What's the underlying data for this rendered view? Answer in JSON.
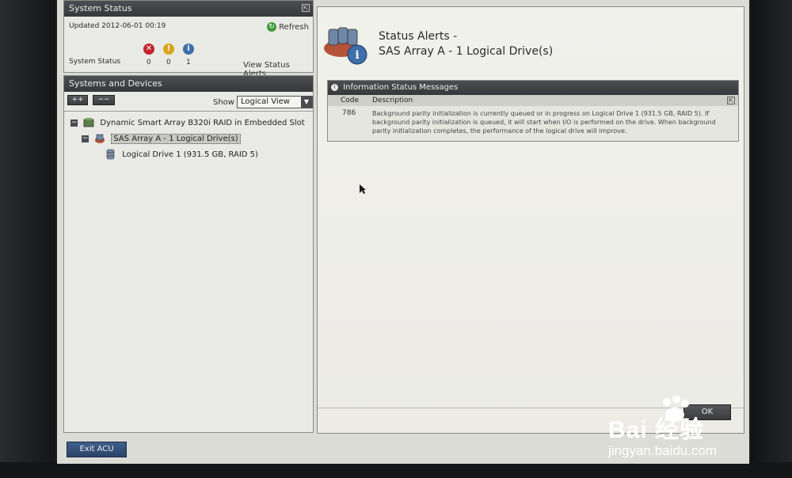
{
  "system_status": {
    "title": "System Status",
    "updated": "Updated 2012-06-01 00:19",
    "refresh": "Refresh",
    "label": "System Status",
    "counts": [
      "0",
      "0",
      "1"
    ],
    "view_alerts": "View Status Alerts"
  },
  "devices": {
    "title": "Systems and Devices",
    "expand_all": "++",
    "collapse_all": "−−",
    "show_label": "Show",
    "view_option": "Logical View",
    "tree": [
      {
        "label": "Dynamic Smart Array B320i RAID in Embedded Slot",
        "expander": "−"
      },
      {
        "label": "SAS Array A - 1 Logical Drive(s)",
        "expander": "−"
      },
      {
        "label": "Logical Drive 1 (931.5 GB, RAID 5)"
      }
    ]
  },
  "alerts": {
    "title_line1": "Status Alerts -",
    "title_line2": "SAS Array A - 1 Logical Drive(s)",
    "section_title": "Information Status Messages",
    "col_code": "Code",
    "col_description": "Description",
    "rows": [
      {
        "code": "786",
        "description": "Background parity initialization is currently queued or in progress on Logical Drive 1 (931.5 GB, RAID 5). If background parity initialization is queued, it will start when I/O is performed on the drive. When background parity initialization completes, the performance of the logical drive will improve."
      }
    ],
    "ok": "OK"
  },
  "footer": {
    "exit": "Exit ACU"
  },
  "watermark": {
    "brand": "Bai 经验",
    "url": "jingyan.baidu.com"
  },
  "colors": {
    "header_dark": "#3a3c40",
    "error_red": "#c0262a",
    "warning_yellow": "#d9a41a",
    "info_blue": "#3e6fa8",
    "refresh_green": "#3f9a3a"
  }
}
